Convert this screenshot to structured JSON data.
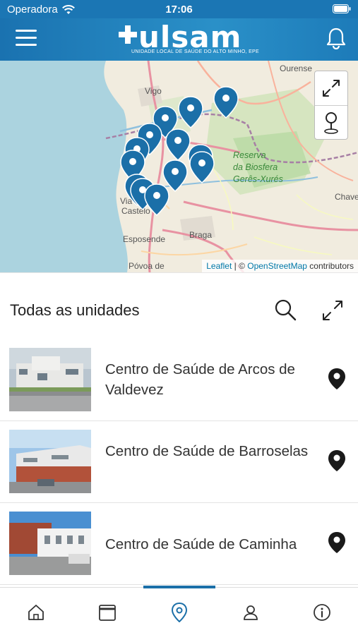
{
  "status_bar": {
    "carrier": "Operadora",
    "time": "17:06"
  },
  "header": {
    "logo_text": "ulsam",
    "logo_subtitle": "UNIDADE LOCAL DE SAÚDE DO ALTO MINHO, EPE",
    "menu_icon": "hamburger-icon",
    "notification_icon": "bell-icon"
  },
  "map": {
    "places": {
      "ourense": "Ourense",
      "vigo": "Vigo",
      "viana": "Via",
      "castelo": "Castelo",
      "braga": "Braga",
      "esposende": "Esposende",
      "povoa": "Póvoa de",
      "chaves": "Chave"
    },
    "reserve_line1": "Reserva",
    "reserve_line2": "da Biosfera",
    "reserve_line3": "Gerês-Xurés",
    "attribution": {
      "leaflet": "Leaflet",
      "separator": " | © ",
      "osm": "OpenStreetMap",
      "contributors": " contributors"
    },
    "marker_color": "#1b6fa8",
    "marker_count": 14
  },
  "list": {
    "title": "Todas as unidades",
    "items": [
      {
        "name": "Centro de Saúde de Arcos de Valdevez"
      },
      {
        "name": "Centro de Saúde de Barroselas"
      },
      {
        "name": "Centro de Saúde de Caminha"
      }
    ]
  },
  "bottom_nav": {
    "items": [
      "home-icon",
      "calendar-icon",
      "map-pin-icon",
      "profile-icon",
      "info-icon"
    ],
    "active": "map-pin-icon",
    "accent": "#1b6fa8"
  }
}
